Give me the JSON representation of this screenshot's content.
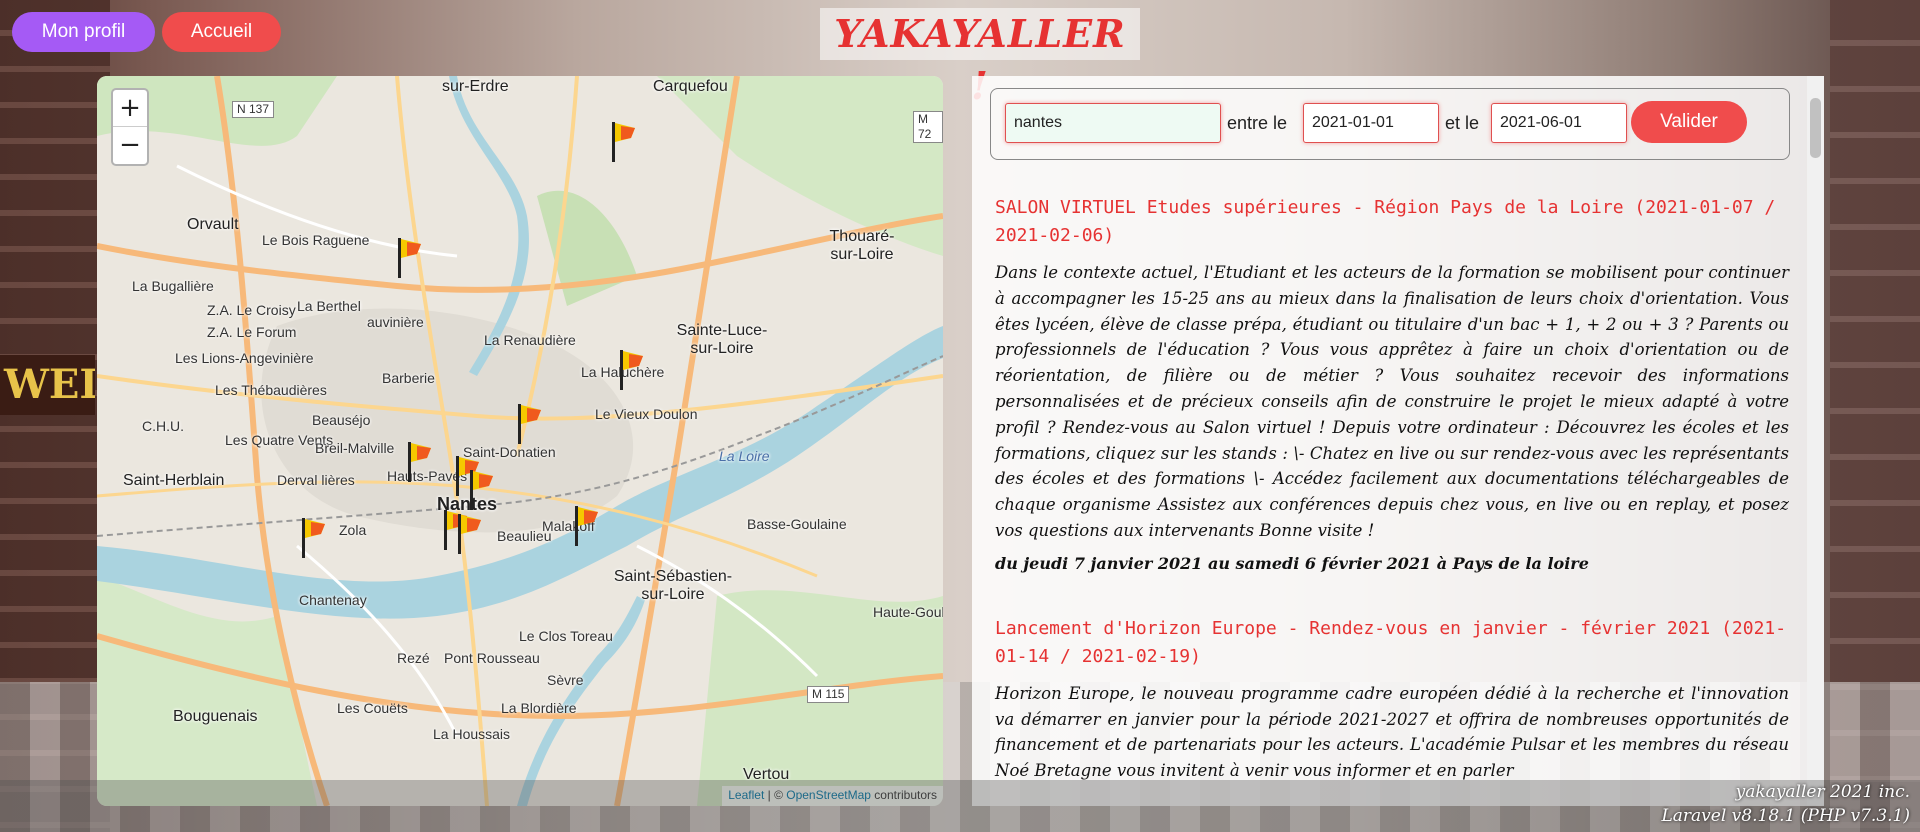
{
  "header": {
    "profile_label": "Mon profil",
    "home_label": "Accueil",
    "brand": "YAKAYALLER !"
  },
  "background": {
    "shop_sign": "WELLS"
  },
  "map": {
    "zoom_in": "+",
    "zoom_out": "−",
    "attribution": {
      "leaflet": "Leaflet",
      "separator": " | © ",
      "osm": "OpenStreetMap",
      "suffix": " contributors"
    },
    "places": [
      "sur-Erdre",
      "Carquefou",
      "Orvault",
      "Le Bois Raguene",
      "La Bugallière",
      "Z.A. Le Croisy",
      "Z.A. Le Forum",
      "Les Lions-Angevinière",
      "Les Thébaudières",
      "C.H.U.",
      "Les Quatre Vents",
      "Breil-Malville",
      "Beauséjo",
      "Derval lières",
      "Saint-Herblain",
      "La Berthel",
      "Barberie",
      "La Renaudière",
      "Sainte-Luce-sur-Loire",
      "Thouaré-sur-Loire",
      "La Haluchère",
      "Le Vieux Doulon",
      "Saint-Donatien",
      "Hauts-Pavés",
      "Nantes",
      "Zola",
      "Malakoff",
      "La Loire",
      "Basse-Goulaine",
      "Beaulieu",
      "Saint-Sébastien-sur-Loire",
      "Chantenay",
      "Le Clos Toreau",
      "Rezé",
      "Pont Rousseau",
      "Bouguenais",
      "Les Couëts",
      "La Blordière",
      "La Houssais",
      "Vertou",
      "Sèvre",
      "Haute-Goul",
      "auvinière"
    ],
    "road_badges": [
      "N 137",
      "M 72",
      "M 115"
    ]
  },
  "search": {
    "city_value": "nantes",
    "between_label": "entre le",
    "date_from": "2021-01-01",
    "and_label": "et le",
    "date_to": "2021-06-01",
    "submit_label": "Valider"
  },
  "events": [
    {
      "title": "SALON VIRTUEL Etudes supérieures - Région Pays de la Loire (2021-01-07 / 2021-02-06)",
      "description": "Dans le contexte actuel, l'Etudiant et les acteurs de la formation se mobilisent pour continuer à accompagner les 15-25 ans au mieux dans la finalisation de leurs choix d'orientation. Vous êtes lycéen, élève de classe prépa, étudiant ou titulaire d'un bac + 1, + 2 ou + 3 ? Parents ou professionnels de l'éducation ? Vous vous apprêtez à faire un choix d'orientation ou de réorientation, de filière ou de métier ? Vous souhaitez recevoir des informations personnalisées et de précieux conseils afin de construire le projet le mieux adapté à votre profil ? Rendez-vous au Salon virtuel ! Depuis votre ordinateur : Découvrez les écoles et les formations, cliquez sur les stands : \\- Chatez en live ou sur rendez-vous avec les représentants des écoles et des formations \\- Accédez facilement aux documentations téléchargeables de chaque organisme Assistez aux conférences depuis chez vous, en live ou en replay, et posez vos questions aux intervenants Bonne visite !",
      "when": "du jeudi 7 janvier 2021 au samedi 6 février 2021 à Pays de la loire"
    },
    {
      "title": "Lancement d'Horizon Europe - Rendez-vous en janvier - février 2021 (2021-01-14 / 2021-02-19)",
      "description": "Horizon Europe, le nouveau programme cadre européen dédié à la recherche et l'innovation va démarrer en janvier pour la période 2021-2027 et offrira de nombreuses opportunités de financement et de partenariats pour les acteurs. L'académie Pulsar et les membres du réseau Noé Bretagne vous invitent à venir vous informer et en parler",
      "when": ""
    }
  ],
  "footer": {
    "line1": "yakayaller 2021 inc.",
    "line2": "Laravel v8.18.1 (PHP v7.3.1)"
  },
  "colors": {
    "accent_red": "#f04c4c",
    "profile_purple": "#a55af5",
    "title_red": "#e63232",
    "river_blue": "#aad3df"
  }
}
